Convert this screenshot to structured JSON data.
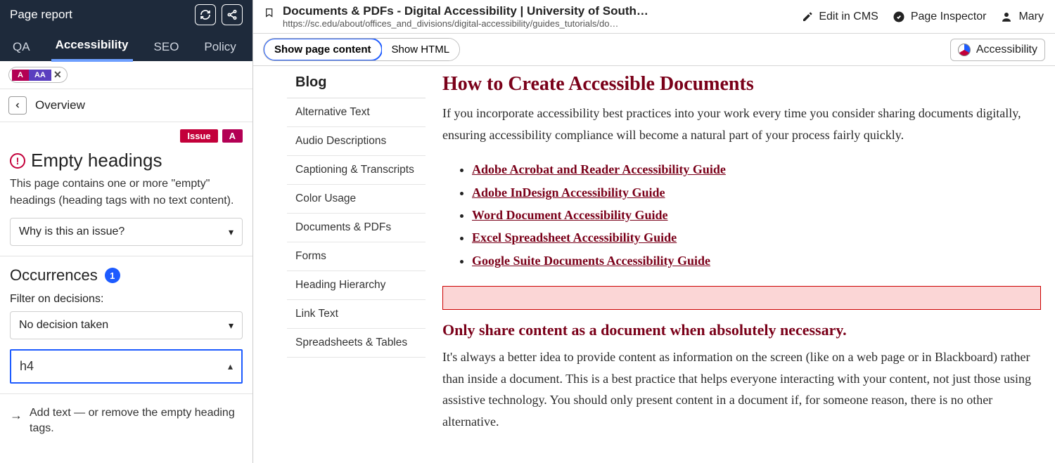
{
  "sidebar": {
    "title": "Page report",
    "tabs": [
      "QA",
      "Accessibility",
      "SEO",
      "Policy"
    ],
    "active_tab_index": 1,
    "levels": {
      "a": "A",
      "aa": "AA"
    },
    "overview_label": "Overview",
    "badges": {
      "issue": "Issue",
      "level": "A"
    },
    "issue": {
      "title": "Empty headings",
      "description": "This page contains one or more \"empty\" headings (heading tags with no text content).",
      "why_label": "Why is this an issue?"
    },
    "occurrences": {
      "title": "Occurrences",
      "count": "1",
      "filter_label": "Filter on decisions:",
      "filter_value": "No decision taken",
      "item_label": "h4",
      "hint": "Add text — or remove the empty heading tags."
    }
  },
  "topbar": {
    "doc_title": "Documents & PDFs - Digital Accessibility | University of South …",
    "doc_url": "https://sc.edu/about/offices_and_divisions/digital-accessibility/guides_tutorials/do…",
    "edit_label": "Edit in CMS",
    "inspector_label": "Page Inspector",
    "user_name": "Mary"
  },
  "toolbar": {
    "seg_show_content": "Show page content",
    "seg_show_html": "Show HTML",
    "chip_label": "Accessibility"
  },
  "blognav": {
    "heading": "Blog",
    "items": [
      "Alternative Text",
      "Audio Descriptions",
      "Captioning & Transcripts",
      "Color Usage",
      "Documents & PDFs",
      "Forms",
      "Heading Hierarchy",
      "Link Text",
      "Spreadsheets & Tables"
    ]
  },
  "article": {
    "h2": "How to Create Accessible Documents",
    "p1": "If you incorporate accessibility best practices into your work every time you consider sharing documents digitally, ensuring accessibility compliance will become a natural part of your process fairly quickly.",
    "links": [
      "Adobe Acrobat and Reader Accessibility Guide",
      "Adobe InDesign Accessibility Guide",
      "Word Document Accessibility Guide",
      "Excel Spreadsheet Accessibility Guide",
      "Google Suite Documents Accessibility Guide"
    ],
    "h3": "Only share content as a document when absolutely necessary.",
    "p2": "It's always a better idea to provide content as information on the screen (like on a web page or in Blackboard) rather than inside a document. This is a best practice that helps everyone interacting with your content, not just those using assistive technology. You should only present content in a document if, for someone reason, there is no other alternative."
  }
}
